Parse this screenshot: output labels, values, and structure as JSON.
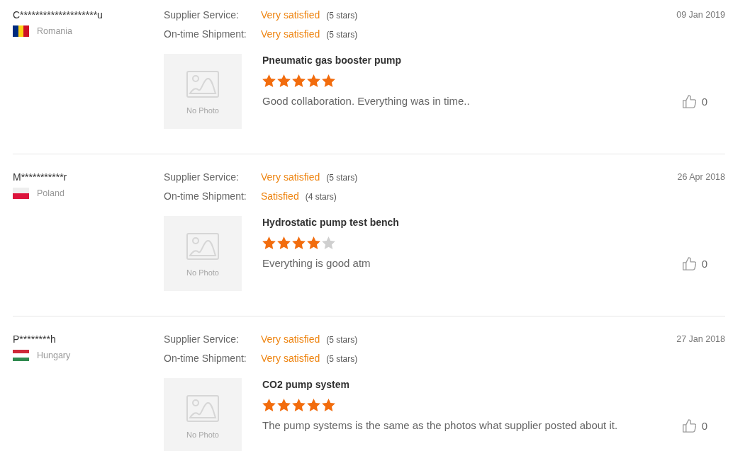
{
  "reviews": [
    {
      "buyer": "C********************u",
      "country": "Romania",
      "flag": {
        "kind": "romania"
      },
      "ratings": [
        {
          "label": "Supplier Service:",
          "value": "Very satisfied",
          "stars_text": "(5 stars)"
        },
        {
          "label": "On-time Shipment:",
          "value": "Very satisfied",
          "stars_text": "(5 stars)"
        }
      ],
      "date": "09 Jan 2019",
      "photo": {
        "label": "No Photo"
      },
      "product": "Pneumatic gas booster pump",
      "stars": 5,
      "comment": "Good collaboration. Everything was in time..",
      "likes": "0"
    },
    {
      "buyer": "M***********r",
      "country": "Poland",
      "flag": {
        "kind": "poland"
      },
      "ratings": [
        {
          "label": "Supplier Service:",
          "value": "Very satisfied",
          "stars_text": "(5 stars)"
        },
        {
          "label": "On-time Shipment:",
          "value": "Satisfied",
          "stars_text": "(4 stars)"
        }
      ],
      "date": "26 Apr 2018",
      "photo": {
        "label": "No Photo"
      },
      "product": "Hydrostatic pump test bench",
      "stars": 4,
      "comment": "Everything is good atm",
      "likes": "0"
    },
    {
      "buyer": "P********h",
      "country": "Hungary",
      "flag": {
        "kind": "hungary"
      },
      "ratings": [
        {
          "label": "Supplier Service:",
          "value": "Very satisfied",
          "stars_text": "(5 stars)"
        },
        {
          "label": "On-time Shipment:",
          "value": "Very satisfied",
          "stars_text": "(5 stars)"
        }
      ],
      "date": "27 Jan 2018",
      "photo": {
        "label": "No Photo"
      },
      "product": "CO2 pump system",
      "stars": 5,
      "comment": "The pump systems is the same as the photos what supplier posted about it.",
      "likes": "0"
    }
  ]
}
